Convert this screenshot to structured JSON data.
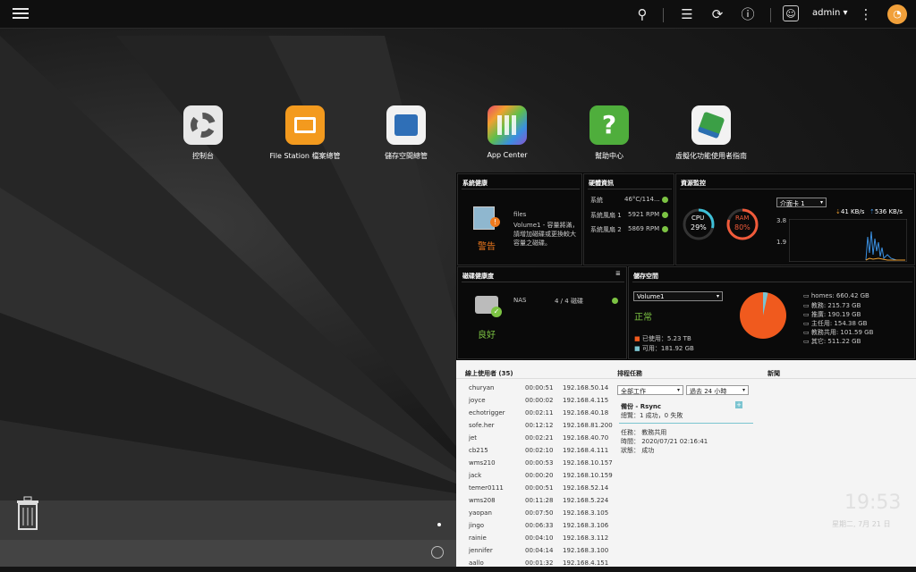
{
  "topbar": {
    "user": "admin"
  },
  "apps": [
    {
      "label": "控制台",
      "icon": "gear-icon"
    },
    {
      "label": "File Station 檔案總管",
      "icon": "folder-icon"
    },
    {
      "label": "儲存空間總管",
      "icon": "storage-icon"
    },
    {
      "label": "App Center",
      "icon": "app-center-icon"
    },
    {
      "label": "幫助中心",
      "icon": "help-icon"
    },
    {
      "label": "虛擬化功能使用者指南",
      "icon": "virtualization-icon"
    }
  ],
  "system_health": {
    "title": "系統健康",
    "name": "files",
    "status": "警告",
    "message": "Volume1 - 容量將滿，請增加磁碟或更換較大容量之磁碟。"
  },
  "hardware": {
    "title": "硬體資訊",
    "rows": [
      {
        "label": "系統",
        "value": "46°C/114..."
      },
      {
        "label": "系統風扇 1",
        "value": "5921 RPM"
      },
      {
        "label": "系統風扇 2",
        "value": "5869 RPM"
      }
    ]
  },
  "resource": {
    "title": "資源監控",
    "cpu_label": "CPU",
    "cpu": "29%",
    "cpu_pct": 29,
    "ram_label": "RAM",
    "ram": "80%",
    "ram_pct": 80,
    "nic": "介面卡 1",
    "down": "41 KB/s",
    "up": "536 KB/s",
    "ymax": "3.8",
    "ymid": "1.9"
  },
  "disk_health": {
    "title": "磁碟健康度",
    "name": "NAS",
    "count": "4 / 4 磁碟",
    "status": "良好"
  },
  "storage": {
    "title": "儲存空間",
    "volume": "Volume1",
    "status": "正常",
    "used": "已使用：5.23 TB",
    "free": "可用：181.92 GB",
    "used_pct": 96.6,
    "shares": [
      "homes: 660.42 GB",
      "教務: 215.73 GB",
      "推廣: 190.19 GB",
      "主任用: 154.38 GB",
      "教務共用: 101.59 GB",
      "其它: 511.22 GB"
    ]
  },
  "online": {
    "title": "線上使用者 (35)",
    "users": [
      [
        "churyan",
        "00:00:51",
        "192.168.50.14"
      ],
      [
        "joyce",
        "00:00:02",
        "192.168.4.115"
      ],
      [
        "echotrigger",
        "00:02:11",
        "192.168.40.18"
      ],
      [
        "sofe.her",
        "00:12:12",
        "192.168.81.200"
      ],
      [
        "jet",
        "00:02:21",
        "192.168.40.70"
      ],
      [
        "cb215",
        "00:02:10",
        "192.168.4.111"
      ],
      [
        "wms210",
        "00:00:53",
        "192.168.10.157"
      ],
      [
        "jack",
        "00:00:20",
        "192.168.10.159"
      ],
      [
        "temer0111",
        "00:00:51",
        "192.168.52.14"
      ],
      [
        "wms208",
        "00:11:28",
        "192.168.5.224"
      ],
      [
        "yaopan",
        "00:07:50",
        "192.168.3.105"
      ],
      [
        "jingo",
        "00:06:33",
        "192.168.3.106"
      ],
      [
        "rainie",
        "00:04:10",
        "192.168.3.112"
      ],
      [
        "jennifer",
        "00:04:14",
        "192.168.3.100"
      ],
      [
        "aallo",
        "00:01:32",
        "192.168.4.151"
      ]
    ]
  },
  "schedule": {
    "title": "排程任務",
    "filter": "全部工作",
    "range": "過去 24 小時",
    "job": "備份 - Rsync",
    "summary": "總覽：1 成功，0 失敗",
    "task": "任務：  教務共用",
    "time": "時間：  2020/07/21 02:16:41",
    "state": "狀態：  成功"
  },
  "news": {
    "title": "新聞"
  },
  "clock": {
    "time": "19:53",
    "date": "星期二, 7月 21 日"
  }
}
